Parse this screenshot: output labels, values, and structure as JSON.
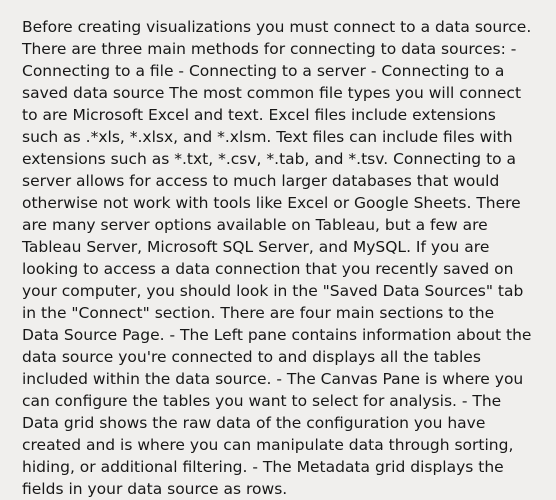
{
  "document": {
    "body": "Before creating visualizations you must connect to a data source. There are three main methods for connecting to data sources: - Connecting to a file - Connecting to a server - Connecting to a saved data source The most common file types you will connect to are Microsoft Excel and text. Excel files include extensions such as .*xls, *.xlsx, and *.xlsm. Text files can include files with extensions such as *.txt, *.csv, *.tab, and *.tsv. Connecting to a server allows for access to much larger databases that would otherwise not work with tools like Excel or Google Sheets. There are many server options available on Tableau, but a few are Tableau Server, Microsoft SQL Server, and MySQL. If you are looking to access a data connection that you recently saved on your computer, you should look in the \"Saved Data Sources\" tab in the \"Connect\" section. There are four main sections to the Data Source Page. - The Left pane contains information about the data source you're connected to and displays all the tables included within the data source. - The Canvas Pane is where you can configure the tables you want to select for analysis. - The Data grid shows the raw data of the configuration you have created and is where you can manipulate data through sorting, hiding, or additional filtering. - The Metadata grid displays the fields in your data source as rows."
  }
}
